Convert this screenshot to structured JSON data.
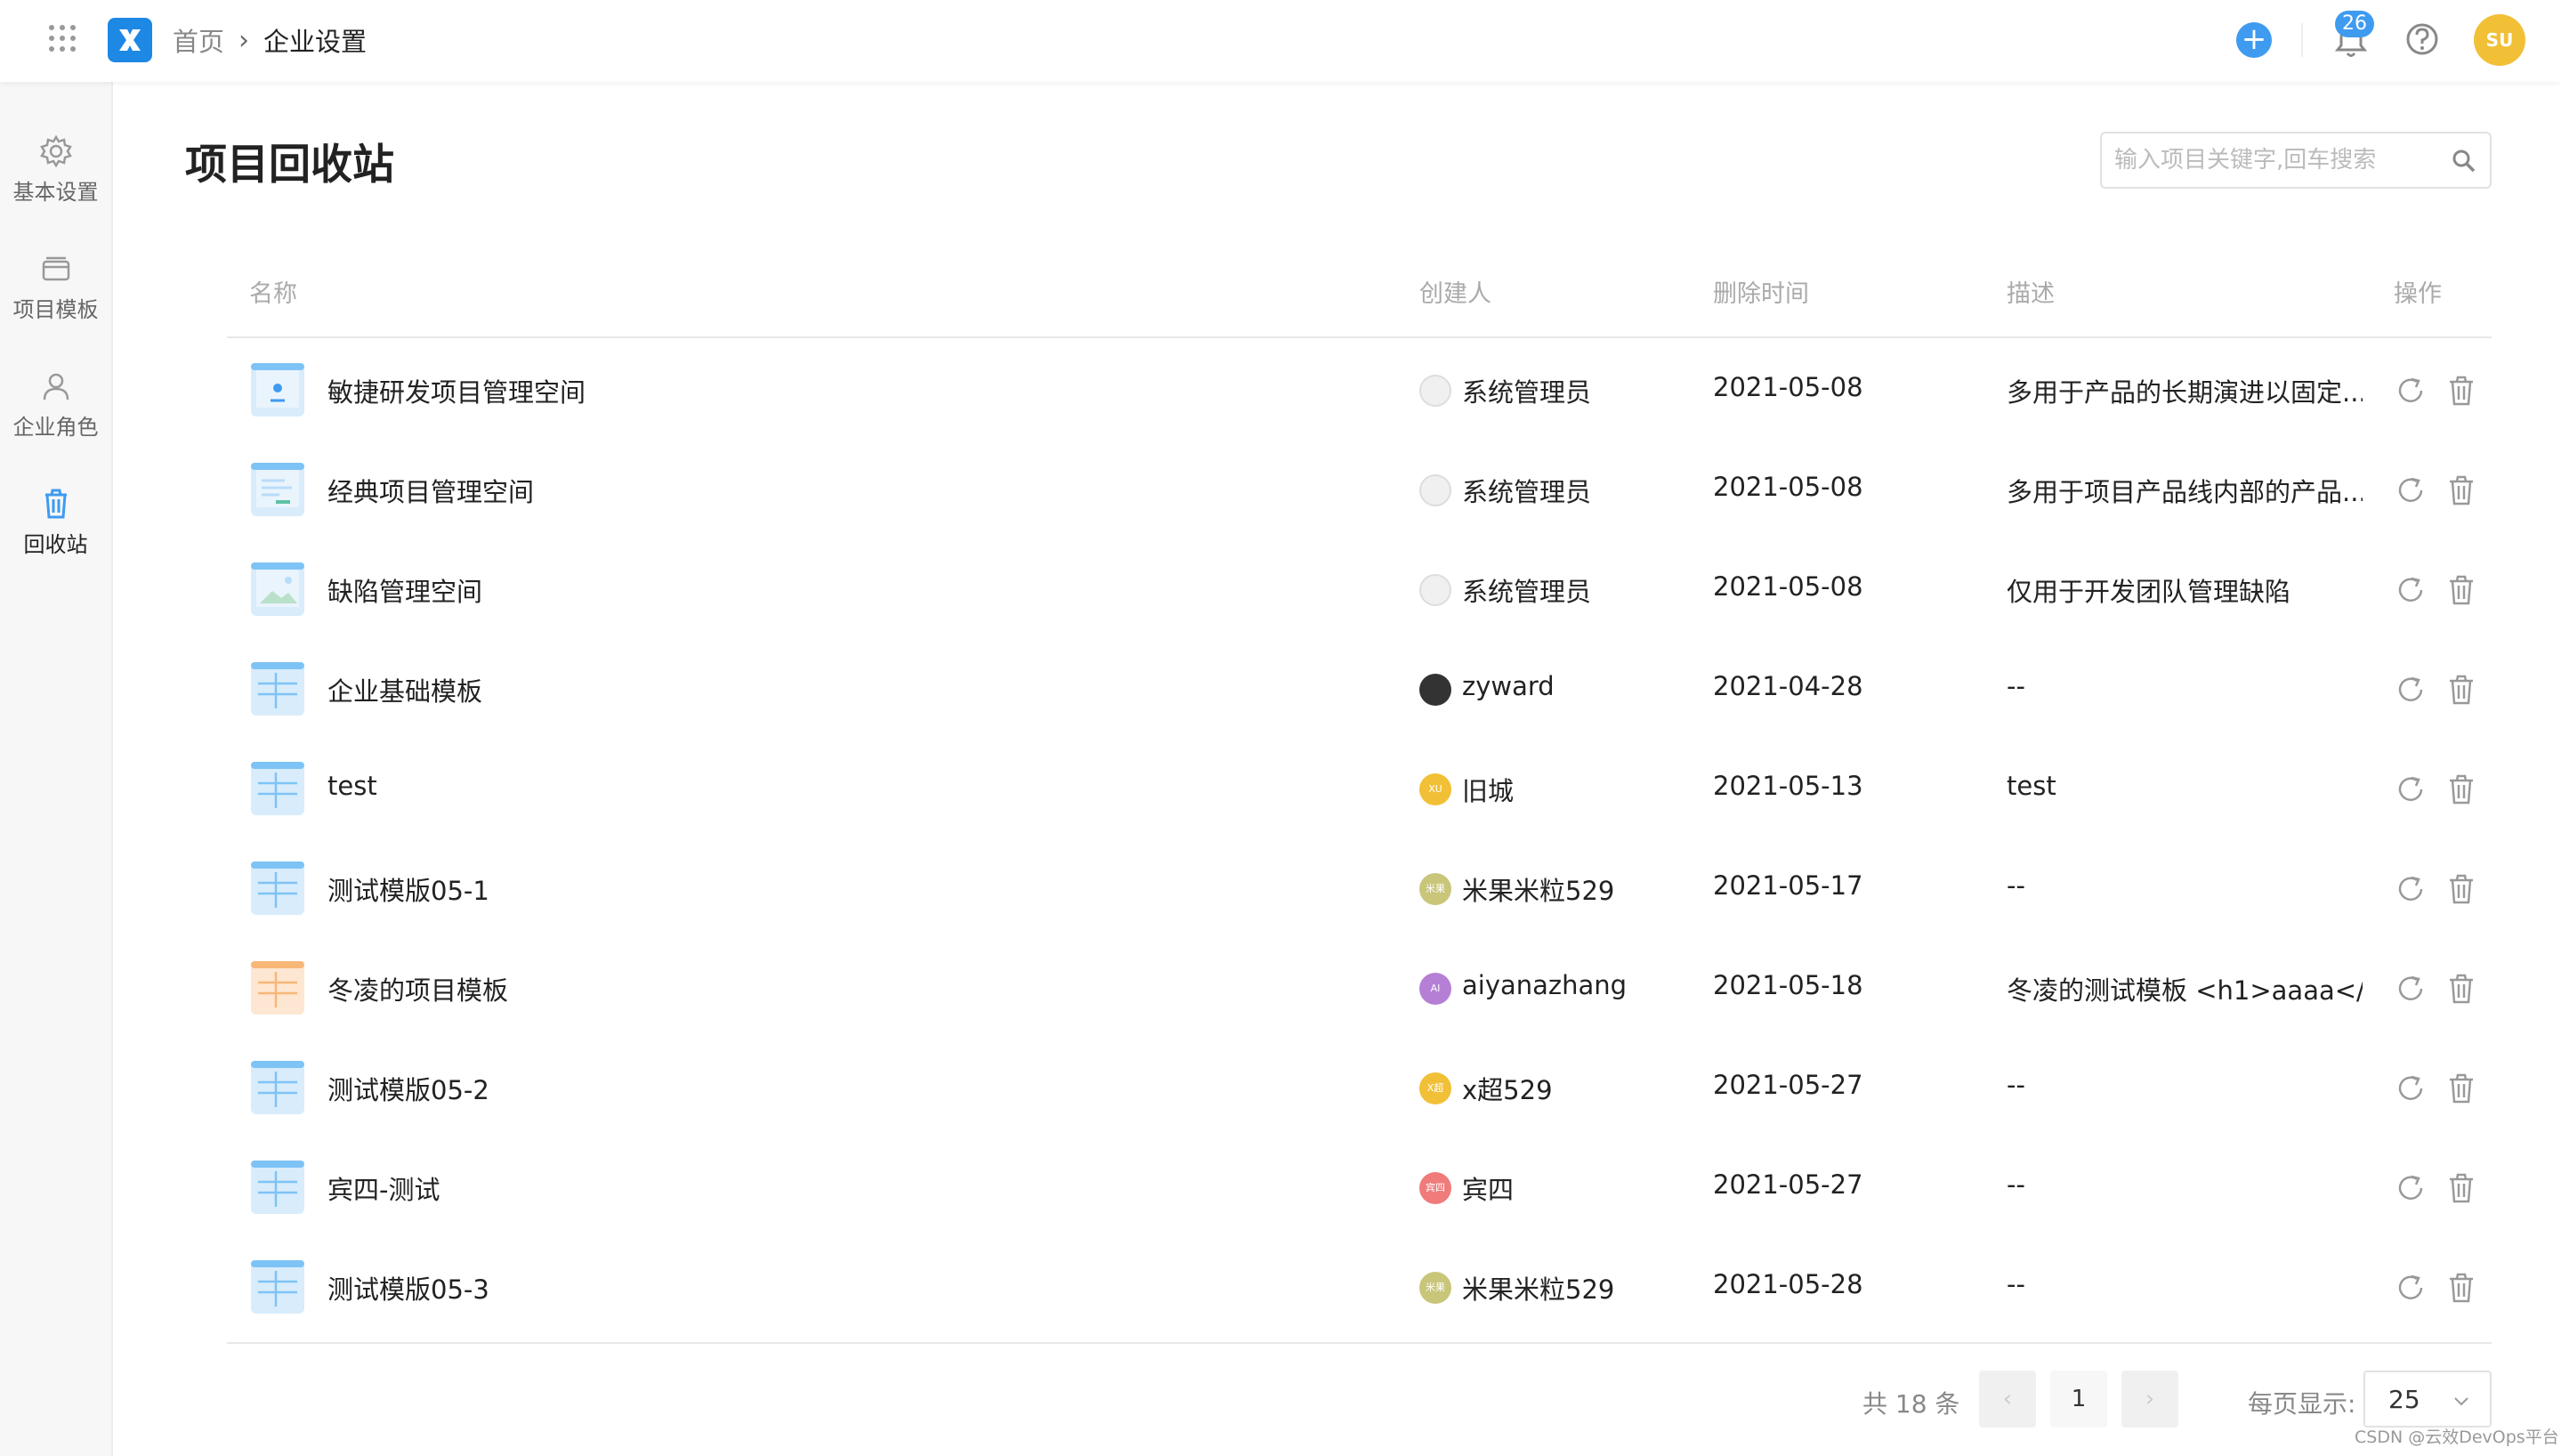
{
  "header": {
    "breadcrumb": {
      "home": "首页",
      "current": "企业设置"
    },
    "notification_count": "26",
    "user_initials": "SU"
  },
  "sidebar": {
    "items": [
      {
        "label": "基本设置",
        "icon": "gear-icon"
      },
      {
        "label": "项目模板",
        "icon": "template-icon"
      },
      {
        "label": "企业角色",
        "icon": "user-role-icon"
      },
      {
        "label": "回收站",
        "icon": "trash-icon"
      }
    ],
    "active_index": 3
  },
  "main": {
    "title": "项目回收站",
    "search": {
      "placeholder": "输入项目关键字,回车搜索",
      "value": ""
    },
    "columns": {
      "name": "名称",
      "creator": "创建人",
      "deleted_time": "删除时间",
      "desc": "描述",
      "actions": "操作"
    },
    "rows": [
      {
        "name": "敏捷研发项目管理空间",
        "creator": "系统管理员",
        "avatar": "",
        "date": "2021-05-08",
        "desc": "多用于产品的长期演进以固定...",
        "icon_style": "light-person"
      },
      {
        "name": "经典项目管理空间",
        "creator": "系统管理员",
        "avatar": "",
        "date": "2021-05-08",
        "desc": "多用于项目产品线内部的产品...",
        "icon_style": "light-bars"
      },
      {
        "name": "缺陷管理空间",
        "creator": "系统管理员",
        "avatar": "",
        "date": "2021-05-08",
        "desc": "仅用于开发团队管理缺陷",
        "icon_style": "light-image"
      },
      {
        "name": "企业基础模板",
        "creator": "zyward",
        "avatar": "",
        "date": "2021-04-28",
        "desc": "--",
        "icon_style": "blue"
      },
      {
        "name": "test",
        "creator": "旧城",
        "avatar": "XU",
        "date": "2021-05-13",
        "desc": "test",
        "icon_style": "blue"
      },
      {
        "name": "测试模版05-1",
        "creator": "米果米粒529",
        "avatar": "米果",
        "date": "2021-05-17",
        "desc": "--",
        "icon_style": "blue"
      },
      {
        "name": "冬凌的项目模板",
        "creator": "aiyanazhang",
        "avatar": "AI",
        "date": "2021-05-18",
        "desc": "冬凌的测试模板 <h1>aaaa</...",
        "icon_style": "orange"
      },
      {
        "name": "测试模版05-2",
        "creator": "x超529",
        "avatar": "X超",
        "date": "2021-05-27",
        "desc": "--",
        "icon_style": "blue"
      },
      {
        "name": "宾四-测试",
        "creator": "宾四",
        "avatar": "宾四",
        "date": "2021-05-27",
        "desc": "--",
        "icon_style": "blue"
      },
      {
        "name": "测试模版05-3",
        "creator": "米果米粒529",
        "avatar": "米果",
        "date": "2021-05-28",
        "desc": "--",
        "icon_style": "blue"
      }
    ],
    "pagination": {
      "total_text": "共 18 条",
      "current_page": "1",
      "page_size_label": "每页显示:",
      "page_size": "25"
    }
  },
  "watermark": "CSDN @云效DevOps平台",
  "colors": {
    "accent": "#3f9bf0",
    "logo": "#1e88e5",
    "avatar_top": "#f2c036"
  }
}
